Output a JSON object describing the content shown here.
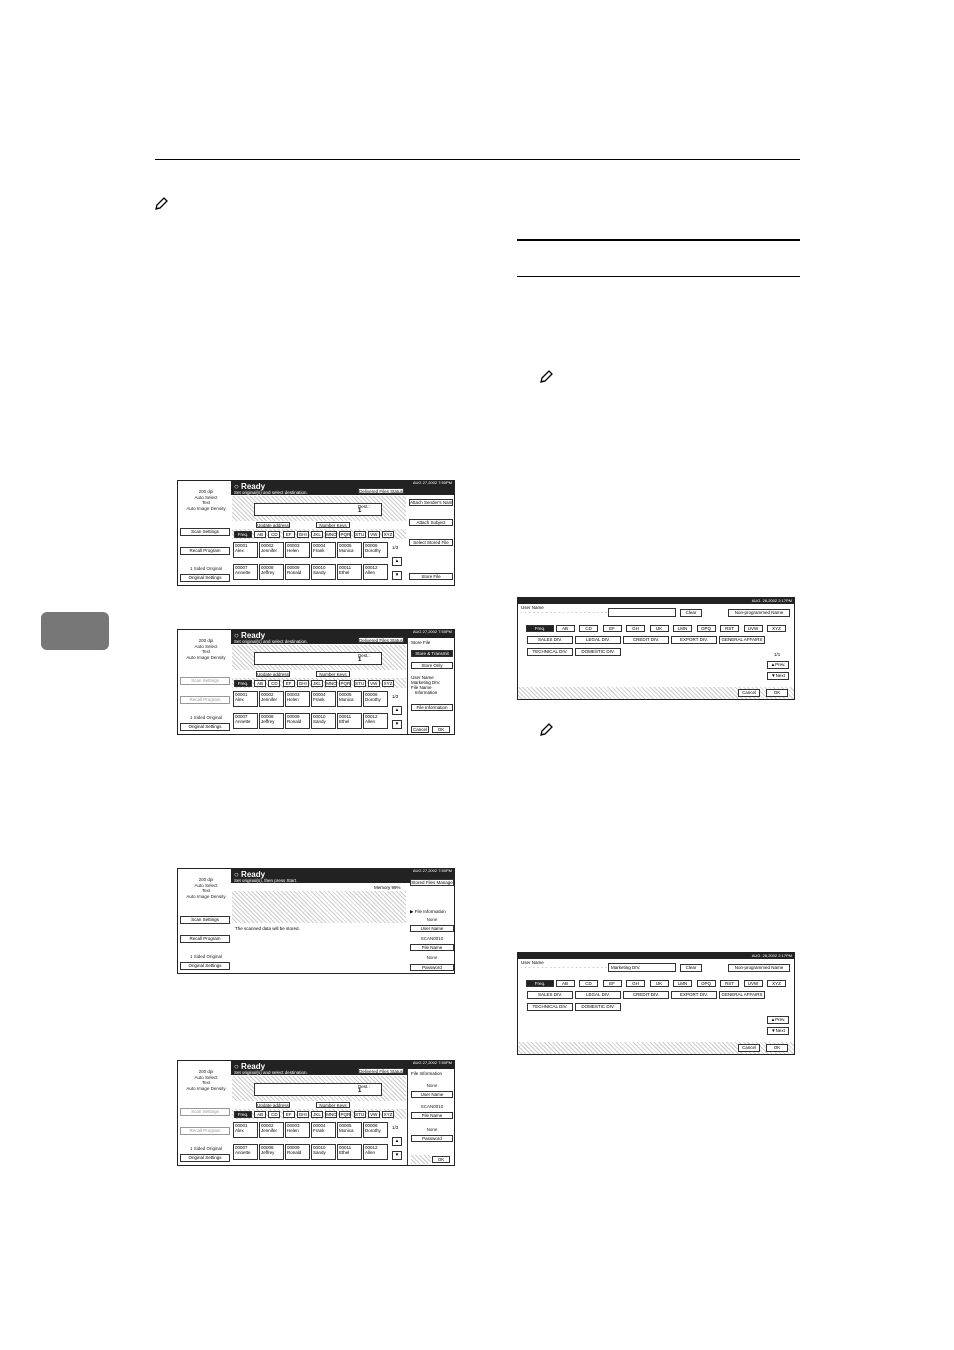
{
  "page": {
    "side_tab_label": "",
    "note_icon": "pencil-note-icon"
  },
  "screen1": {
    "date": "AUG 27,2002 7:50PM",
    "left_info": "200 dpi\nAuto Select\nText\nAuto Image Density",
    "left_buttons": [
      "Scan Settings",
      "Recall Program"
    ],
    "original_label": "1 Sided Original",
    "original_button": "Original Settings",
    "ready": "Ready",
    "subtitle": "Set original(s) and select destination.",
    "memory": "Memory 100%",
    "delivered_btn": "Delivered Files Status",
    "dest_label": "Dest.:",
    "dest_count": "1",
    "update_btn": "Update address",
    "number_btn": "Number Keys",
    "tabs": [
      "Freq.",
      "AB",
      "CD",
      "EF",
      "GHI",
      "JKL",
      "MNO",
      "PQR",
      "STU",
      "VW",
      "XYZ"
    ],
    "row1": [
      [
        "00001",
        "Alex"
      ],
      [
        "00002",
        "Jennifer"
      ],
      [
        "00003",
        "Helen"
      ],
      [
        "00004",
        "Frank"
      ],
      [
        "00005",
        "Monica"
      ],
      [
        "00006",
        "Dorothy"
      ]
    ],
    "row2": [
      [
        "00007",
        "Annette"
      ],
      [
        "00008",
        "Jeffrey"
      ],
      [
        "00009",
        "Ronald"
      ],
      [
        "00010",
        "Sandy"
      ],
      [
        "00011",
        "Ethel"
      ],
      [
        "00012",
        "Allen"
      ]
    ],
    "page_indicator": "1/3",
    "right_buttons": [
      "Attach Sender's Name",
      "Attach Subject",
      "Select Stored File",
      "Store File"
    ]
  },
  "screen2": {
    "date": "AUG 27,2002 7:50PM",
    "left_info": "200 dpi\nAuto Select\nText\nAuto Image Density",
    "left_buttons": [
      "Scan Settings",
      "Recall Program"
    ],
    "original_label": "1 Sided Original",
    "original_button": "Original Settings",
    "ready": "Ready",
    "subtitle": "Set original(s) and select destination.",
    "memory": "Memory 99%",
    "delivered_btn": "Delivered Files Status",
    "dest_label": "Dest.:",
    "dest_count": "1",
    "update_btn": "Update address",
    "number_btn": "Number Keys",
    "tabs": [
      "Freq.",
      "AB",
      "CD",
      "EF",
      "GHI",
      "JKL",
      "MNO",
      "PQR",
      "STU",
      "VW",
      "XYZ"
    ],
    "row1": [
      [
        "00001",
        "Alex"
      ],
      [
        "00002",
        "Jennifer"
      ],
      [
        "00003",
        "Helen"
      ],
      [
        "00004",
        "Frank"
      ],
      [
        "00005",
        "Monica"
      ],
      [
        "00006",
        "Dorothy"
      ]
    ],
    "row2": [
      [
        "00007",
        "Annette"
      ],
      [
        "00008",
        "Jeffrey"
      ],
      [
        "00009",
        "Ronald"
      ],
      [
        "00010",
        "Sandy"
      ],
      [
        "00011",
        "Ethel"
      ],
      [
        "00012",
        "Allen"
      ]
    ],
    "page_indicator": "1/3",
    "store_file": "Store File",
    "store_transmit": "Store & Transmit",
    "store_only": "Store Only",
    "user_name_label": "User Name",
    "user_name_value": "Marketing DIV.",
    "file_name_label": "File Name",
    "file_name_value": "Information",
    "file_info_btn": "File Information",
    "cancel": "Cancel",
    "ok": "OK"
  },
  "screen3": {
    "date": "AUG 27,2002 7:50PM",
    "left_info": "200 dpi\nAuto Select\nText\nAuto Image Density",
    "left_buttons": [
      "Scan Settings",
      "Recall Program"
    ],
    "original_label": "1 Sided Original",
    "original_button": "Original Settings",
    "ready": "Ready",
    "subtitle": "Set original(s), then press Start.",
    "memory": "Memory 99%",
    "stored_btn": "Stored Files Manage",
    "message": "The scanned data will be stored.",
    "file_info": "File Information",
    "none1": "None",
    "user_name_btn": "User Name",
    "file_no": "SCAN0010",
    "file_name_btn": "File Name",
    "none2": "None",
    "password_btn": "Password"
  },
  "screen4": {
    "date": "AUG 27,2002 7:50PM",
    "left_info": "200 dpi\nAuto Select\nText\nAuto Image Density",
    "left_buttons": [
      "Scan Settings",
      "Recall Program"
    ],
    "original_label": "1 Sided Original",
    "original_button": "Original Settings",
    "ready": "Ready",
    "subtitle": "Set original(s) and select destination.",
    "memory": "Memory 99%",
    "delivered_btn": "Delivered Files Status",
    "dest_label": "Dest.:",
    "dest_count": "1",
    "update_btn": "Update address",
    "number_btn": "Number Keys",
    "tabs": [
      "Freq.",
      "AB",
      "CD",
      "EF",
      "GHI",
      "JKL",
      "MNO",
      "PQR",
      "STU",
      "VW",
      "XYZ"
    ],
    "row1": [
      [
        "00001",
        "Alex"
      ],
      [
        "00002",
        "Jennifer"
      ],
      [
        "00003",
        "Helen"
      ],
      [
        "00004",
        "Frank"
      ],
      [
        "00005",
        "Monica"
      ],
      [
        "00006",
        "Dorothy"
      ]
    ],
    "row2": [
      [
        "00007",
        "Annette"
      ],
      [
        "00008",
        "Jeffrey"
      ],
      [
        "00009",
        "Ronald"
      ],
      [
        "00010",
        "Sandy"
      ],
      [
        "00011",
        "Ethel"
      ],
      [
        "00012",
        "Allen"
      ]
    ],
    "page_indicator": "1/3",
    "file_info": "File Information",
    "none1": "None",
    "user_name_btn": "User Name",
    "file_no": "SCAN0010",
    "file_name_btn": "File Name",
    "none2": "None",
    "password_btn": "Password",
    "ok": "OK"
  },
  "screen5": {
    "date": "AUG. 26,2002 2:17PM",
    "title": "User Name",
    "field_value": "",
    "clear": "Clear",
    "non_programmed": "Non-programmed Name",
    "tabs": [
      "Freq.",
      "AB",
      "CD",
      "EF",
      "GH",
      "IJK",
      "LMN",
      "OPQ",
      "RST",
      "UVW",
      "XYZ"
    ],
    "names_row1": [
      "SALES DIV.",
      "LEGAL DIV.",
      "CREDIT DIV.",
      "EXPORT DIV.",
      "GENERAL AFFAIRS"
    ],
    "names_row2": [
      "TECHNICAL DIV.",
      "DOMESTIC DIV."
    ],
    "page_indicator": "1/1",
    "prev": "Prev.",
    "next": "Next",
    "cancel": "Cancel",
    "ok": "OK"
  },
  "screen6": {
    "date": "AUG. 26,2002 2:17PM",
    "title": "User Name",
    "field_value": "Marketing DIV.",
    "clear": "Clear",
    "non_programmed": "Non-programmed Name",
    "tabs": [
      "Freq.",
      "AB",
      "CD",
      "EF",
      "GH",
      "IJK",
      "LMN",
      "OPQ",
      "RST",
      "UVW",
      "XYZ"
    ],
    "names_row1": [
      "SALES DIV.",
      "LEGAL DIV.",
      "CREDIT DIV.",
      "EXPORT DIV.",
      "GENERAL AFFAIRS"
    ],
    "names_row2": [
      "TECHNICAL DIV.",
      "DOMESTIC DIV."
    ],
    "prev": "Prev.",
    "next": "Next",
    "cancel": "Cancel",
    "ok": "OK"
  }
}
